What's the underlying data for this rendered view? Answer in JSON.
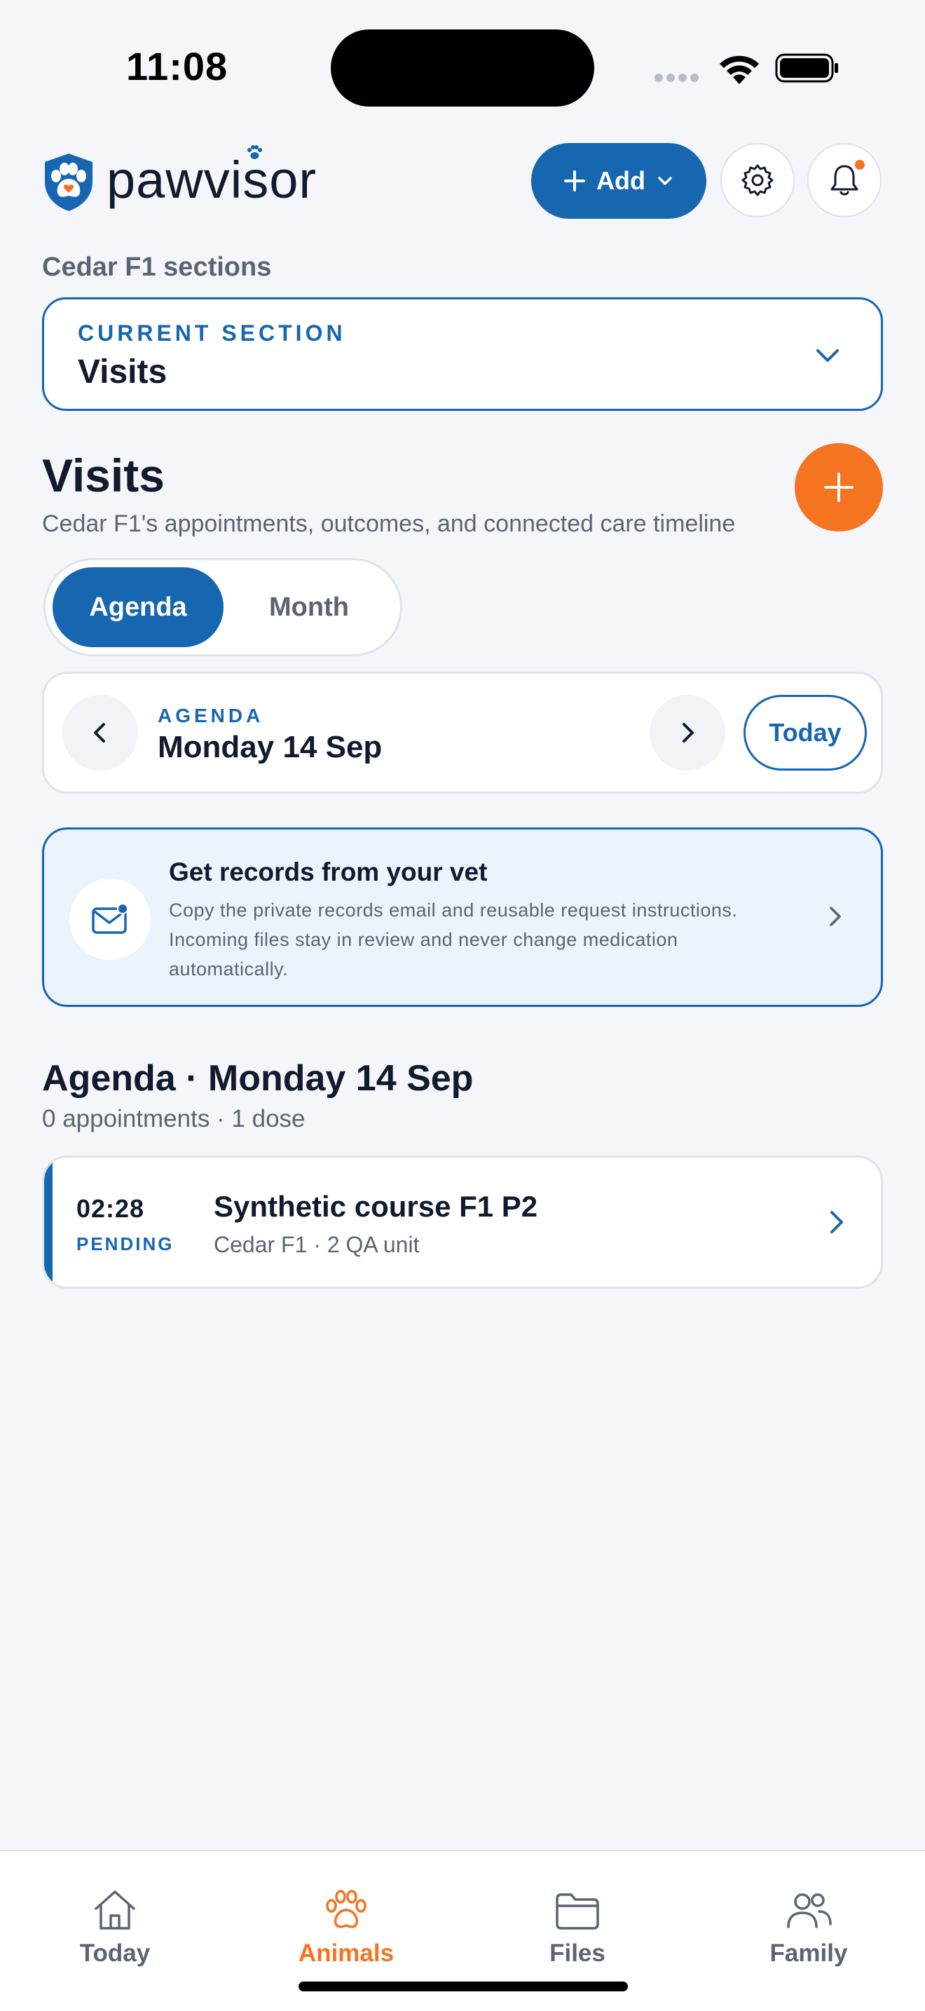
{
  "status_bar": {
    "time": "11:08"
  },
  "header": {
    "logo_text": "pawvisor",
    "add_label": "Add"
  },
  "section_picker": {
    "label": "Cedar F1 sections",
    "overline": "CURRENT SECTION",
    "value": "Visits"
  },
  "page": {
    "title": "Visits",
    "subtitle": "Cedar F1's appointments, outcomes, and connected care timeline"
  },
  "view_toggle": {
    "options": [
      "Agenda",
      "Month"
    ],
    "selected": "Agenda"
  },
  "date_nav": {
    "overline": "AGENDA",
    "date": "Monday 14 Sep",
    "today_label": "Today"
  },
  "records_card": {
    "title": "Get records from your vet",
    "body": "Copy the private records email and reusable request instructions. Incoming files stay in review and never change medication automatically."
  },
  "agenda": {
    "heading": "Agenda · Monday 14 Sep",
    "summary": "0 appointments · 1 dose",
    "items": [
      {
        "time": "02:28",
        "status": "PENDING",
        "title": "Synthetic course F1 P2",
        "subtitle": "Cedar F1 · 2 QA unit"
      }
    ]
  },
  "tab_bar": {
    "tabs": [
      {
        "label": "Today",
        "icon": "home-icon"
      },
      {
        "label": "Animals",
        "icon": "paw-icon"
      },
      {
        "label": "Files",
        "icon": "folder-icon"
      },
      {
        "label": "Family",
        "icon": "people-icon"
      }
    ],
    "active": "Animals"
  },
  "colors": {
    "primary": "#1766b0",
    "accent": "#f47421",
    "background": "#f4f6fa",
    "text": "#111a2e",
    "muted": "#5c6473"
  }
}
